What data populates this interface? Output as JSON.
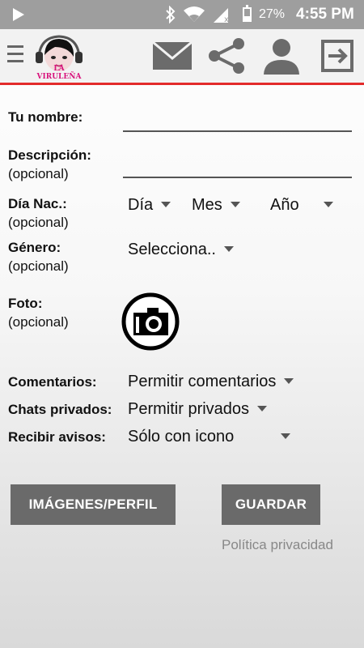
{
  "status_bar": {
    "battery": "27%",
    "time": "4:55 PM",
    "icons": [
      "play-icon",
      "bluetooth-icon",
      "wifi-icon",
      "no-sim-icon",
      "battery-icon"
    ]
  },
  "toolbar": {
    "logo_text": "LA VIRULEÑA",
    "icons": [
      "menu-icon",
      "mail-icon",
      "share-icon",
      "profile-icon",
      "logout-icon"
    ]
  },
  "form": {
    "name_label": "Tu nombre:",
    "description_label": "Descripción:",
    "description_optional": "(opcional)",
    "birth_label": "Día Nac.:",
    "birth_optional": "(opcional)",
    "birth_day": "Día",
    "birth_month": "Mes",
    "birth_year": "Año",
    "gender_label": "Género:",
    "gender_optional": "(opcional)",
    "gender_value": "Selecciona..",
    "photo_label": "Foto:",
    "photo_optional": "(opcional)",
    "comments_label": "Comentarios:",
    "comments_value": "Permitir comentarios",
    "chats_label": "Chats privados:",
    "chats_value": "Permitir privados",
    "notify_label": "Recibir avisos:",
    "notify_value": "Sólo con icono"
  },
  "actions": {
    "images_button": "IMÁGENES/PERFIL",
    "save_button": "GUARDAR",
    "privacy_link": "Política privacidad"
  },
  "colors": {
    "accent_line": "#e32b2b",
    "button_bg": "#6a6a6a",
    "statusbar_bg": "#9e9e9e"
  }
}
